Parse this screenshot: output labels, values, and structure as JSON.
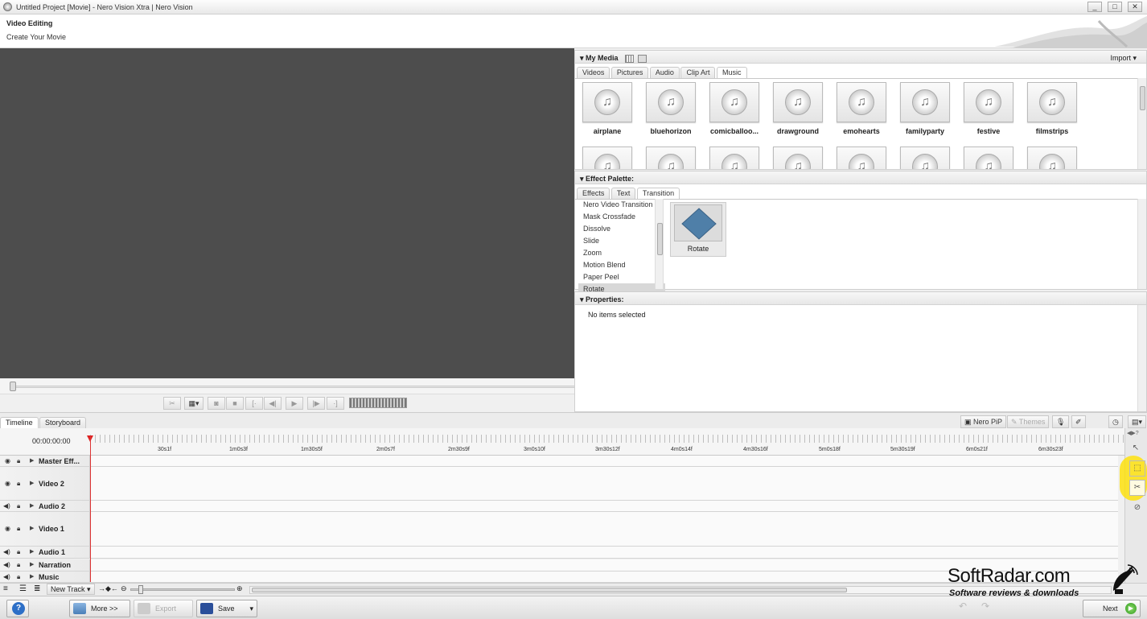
{
  "window": {
    "title": "Untitled Project [Movie] - Nero Vision Xtra | Nero Vision",
    "minimize": "_",
    "maximize": "□",
    "close": "✕"
  },
  "header": {
    "title": "Video Editing",
    "subtitle": "Create Your Movie"
  },
  "my_media": {
    "title": "My Media",
    "import_label": "Import ▾",
    "tabs": [
      "Videos",
      "Pictures",
      "Audio",
      "Clip Art",
      "Music"
    ],
    "active_tab": "Music",
    "items": [
      "airplane",
      "bluehorizon",
      "comicballoo...",
      "drawground",
      "emohearts",
      "familyparty",
      "festive",
      "filmstrips"
    ]
  },
  "effect_palette": {
    "title": "Effect Palette:",
    "tabs": [
      "Effects",
      "Text",
      "Transition"
    ],
    "active_tab": "Transition",
    "list": [
      "Nero Video Transition",
      "Mask Crossfade",
      "Dissolve",
      "Slide",
      "Zoom",
      "Motion Blend",
      "Paper Peel",
      "Rotate"
    ],
    "selected": "Rotate",
    "preview_label": "Rotate"
  },
  "properties": {
    "title": "Properties:",
    "empty_text": "No items selected"
  },
  "timeline": {
    "tabs": [
      "Timeline",
      "Storyboard"
    ],
    "active_tab": "Timeline",
    "nero_pip": "Nero PiP",
    "themes": "Themes",
    "current_time": "00:00:00:00",
    "ticks": [
      "30s1f",
      "1m0s3f",
      "1m30s5f",
      "2m0s7f",
      "2m30s9f",
      "3m0s10f",
      "3m30s12f",
      "4m0s14f",
      "4m30s16f",
      "5m0s18f",
      "5m30s19f",
      "6m0s21f",
      "6m30s23f"
    ],
    "tracks": [
      "Master Eff...",
      "Video 2",
      "Audio 2",
      "Video 1",
      "Audio 1",
      "Narration",
      "Music"
    ],
    "new_track": "New Track ▾"
  },
  "footer": {
    "help": "?",
    "more": "More >>",
    "export": "Export",
    "save": "Save",
    "next": "Next"
  },
  "watermark": {
    "brand": "SoftRadar.com",
    "tagline": "Software reviews & downloads"
  },
  "colors": {
    "preview_bg": "#4d4d4d",
    "playhead": "#dd3333",
    "highlight": "#ffe100",
    "transition_icon": "#4f7fa8"
  }
}
